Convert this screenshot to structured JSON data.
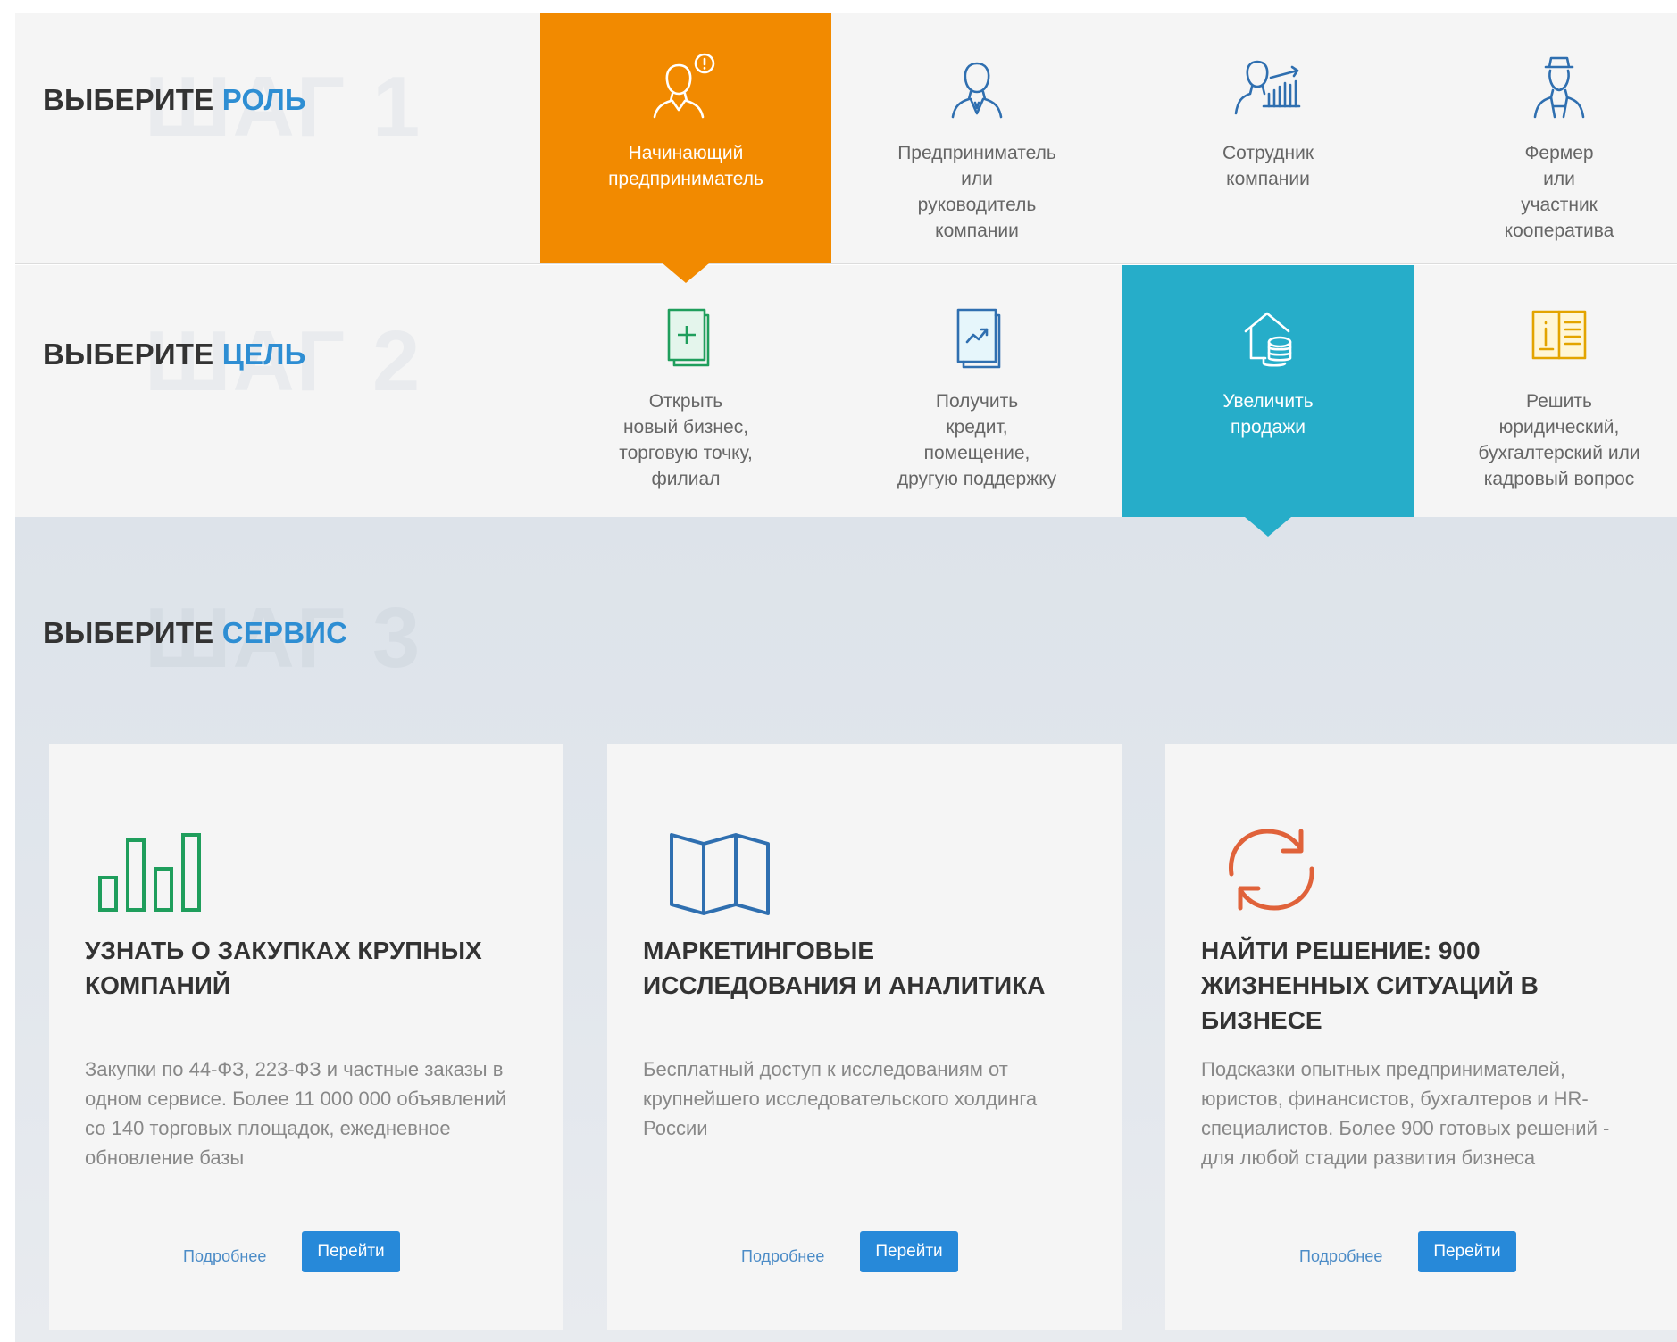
{
  "step1": {
    "title_prefix": "ВЫБЕРИТЕ",
    "title_accent": "РОЛЬ",
    "bg": "ШАГ 1",
    "options": [
      {
        "label": "Начинающий\nпредприниматель",
        "icon": "beginner-entrepreneur-icon",
        "active": true
      },
      {
        "label": "Предприниматель\nили\nруководитель\nкомпании",
        "icon": "entrepreneur-icon",
        "active": false
      },
      {
        "label": "Сотрудник\nкомпании",
        "icon": "employee-icon",
        "active": false
      },
      {
        "label": "Фермер\nили\nучастник\nкооператива",
        "icon": "farmer-icon",
        "active": false
      }
    ]
  },
  "step2": {
    "title_prefix": "ВЫБЕРИТЕ",
    "title_accent": "ЦЕЛЬ",
    "bg": "ШАГ 2",
    "options": [
      {
        "label": "Открыть\nновый бизнес,\nторговую точку,\nфилиал",
        "icon": "new-document-icon",
        "active": false
      },
      {
        "label": "Получить\nкредит,\nпомещение,\nдругую поддержку",
        "icon": "growth-chart-icon",
        "active": false
      },
      {
        "label": "Увеличить\nпродажи",
        "icon": "house-coins-icon",
        "active": true
      },
      {
        "label": "Решить\nюридический,\nбухгалтерский или\nкадровый вопрос",
        "icon": "open-book-icon",
        "active": false
      }
    ]
  },
  "step3": {
    "title_prefix": "ВЫБЕРИТЕ",
    "title_accent": "СЕРВИС",
    "bg": "ШАГ 3",
    "cards": [
      {
        "icon": "bar-chart-icon",
        "title": "УЗНАТЬ О ЗАКУПКАХ КРУПНЫХ КОМПАНИЙ",
        "text": "Закупки по 44-ФЗ, 223-ФЗ и частные заказы в одном сервисе. Более 11 000 000 объявлений со 140 торговых площадок, ежедневное обновление базы",
        "more": "Подробнее",
        "go": "Перейти"
      },
      {
        "icon": "folded-map-icon",
        "title": "МАРКЕТИНГОВЫЕ ИССЛЕДОВАНИЯ И АНАЛИТИКА",
        "text": "Бесплатный доступ к исследованиям от крупнейшего исследовательского холдинга России",
        "more": "Подробнее",
        "go": "Перейти"
      },
      {
        "icon": "refresh-cycle-icon",
        "title": "НАЙТИ РЕШЕНИЕ: 900 ЖИЗНЕННЫХ СИТУАЦИЙ В БИЗНЕСЕ",
        "text": "Подсказки опытных предпринимателей, юристов, финансистов, бухгалтеров и HR-специалистов. Более 900 готовых решений - для любой стадии развития бизнеса",
        "more": "Подробнее",
        "go": "Перейти"
      }
    ]
  },
  "colors": {
    "accent": "#2e8ed3",
    "orange": "#f28a00",
    "teal": "#26adc9",
    "green_icon": "#1f9e5c",
    "blue_icon": "#2f6fb0",
    "red_icon": "#e0623a",
    "button": "#2789d9"
  }
}
